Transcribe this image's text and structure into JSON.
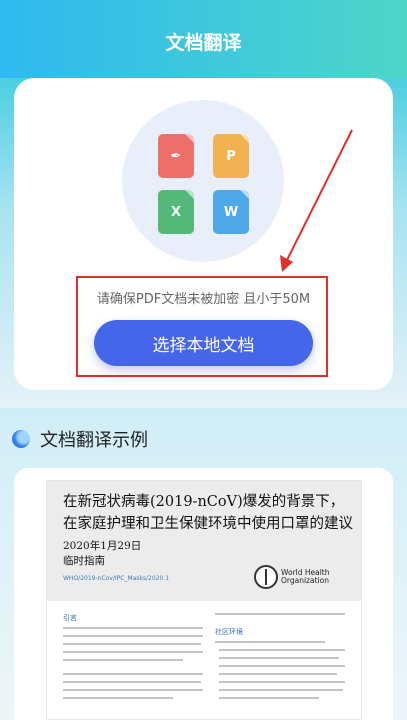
{
  "header": {
    "title": "文档翻译"
  },
  "upload_card": {
    "icons": [
      {
        "name": "pdf-icon",
        "glyph": "✒",
        "color": "#ec6f6a"
      },
      {
        "name": "ppt-icon",
        "glyph": "P",
        "color": "#f2b24f"
      },
      {
        "name": "excel-icon",
        "glyph": "X",
        "color": "#53b978"
      },
      {
        "name": "word-icon",
        "glyph": "W",
        "color": "#4da7e8"
      }
    ],
    "hint": "请确保PDF文档未被加密 且小于50M",
    "select_button": "选择本地文档"
  },
  "example_section": {
    "title": "文档翻译示例",
    "doc": {
      "title": "在新冠状病毒(2019-nCoV)爆发的背景下，在家庭护理和卫生保健环境中使用口罩的建议",
      "date": "2020年1月29日",
      "subtitle": "临时指南",
      "ref": "WHO/2019-nCov/IPC_Masks/2020.1",
      "org": "World Health Organization",
      "col_left_head": "引言",
      "col_right_head": "社区环境"
    }
  },
  "colors": {
    "accent": "#4566e9",
    "annotation": "#e0302b"
  }
}
